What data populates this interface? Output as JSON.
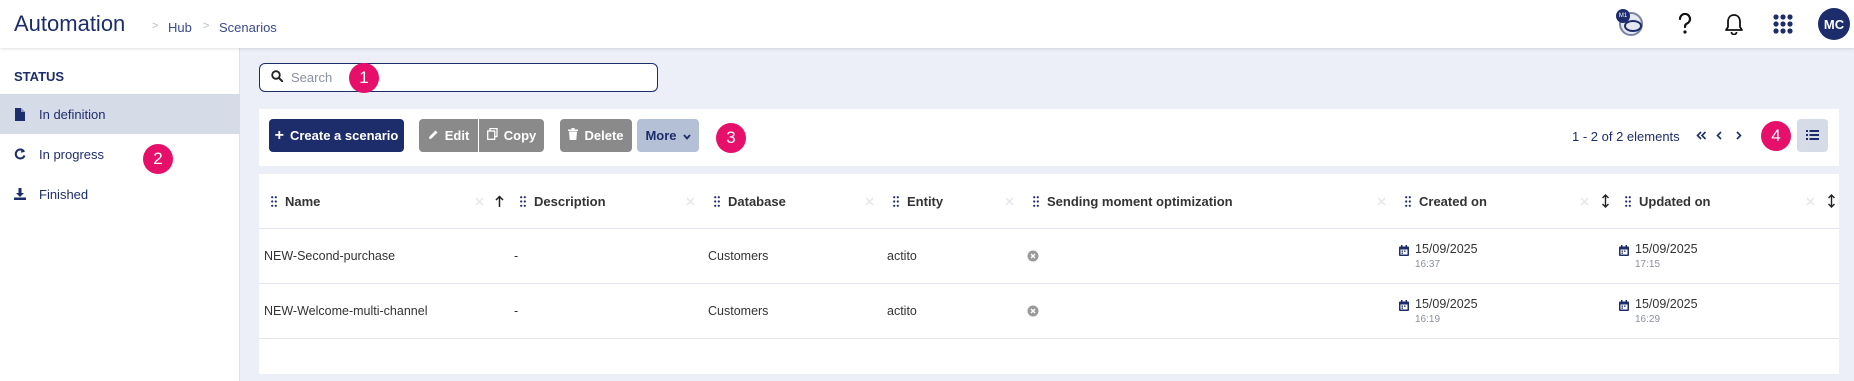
{
  "header": {
    "app_title": "Automation",
    "breadcrumb": [
      "Hub",
      "Scenarios"
    ],
    "avatar_badge": "M1",
    "user_initials": "MC"
  },
  "sidebar": {
    "heading": "STATUS",
    "items": [
      {
        "label": "In definition",
        "icon": "file-icon",
        "active": true
      },
      {
        "label": "In progress",
        "icon": "refresh-icon",
        "active": false
      },
      {
        "label": "Finished",
        "icon": "download-icon",
        "active": false
      }
    ]
  },
  "search": {
    "placeholder": "Search",
    "value": ""
  },
  "toolbar": {
    "create_label": "Create a scenario",
    "edit_label": "Edit",
    "copy_label": "Copy",
    "delete_label": "Delete",
    "more_label": "More",
    "pagination_text": "1 - 2 of 2 elements"
  },
  "markers": [
    "1",
    "2",
    "3",
    "4"
  ],
  "table": {
    "columns": [
      "Name",
      "Description",
      "Database",
      "Entity",
      "Sending moment optimization",
      "Created on",
      "Updated on"
    ],
    "rows": [
      {
        "name": "NEW-Second-purchase",
        "description": "-",
        "database": "Customers",
        "entity": "actito",
        "created_date": "15/09/2025",
        "created_time": "16:37",
        "updated_date": "15/09/2025",
        "updated_time": "17:15"
      },
      {
        "name": "NEW-Welcome-multi-channel",
        "description": "-",
        "database": "Customers",
        "entity": "actito",
        "created_date": "15/09/2025",
        "created_time": "16:19",
        "updated_date": "15/09/2025",
        "updated_time": "16:29"
      }
    ]
  },
  "colors": {
    "brand": "#1d2d6b",
    "marker": "#e6106a",
    "background": "#eceff7",
    "grey_button": "#8a8a8a",
    "more_button": "#b4c0d6"
  }
}
